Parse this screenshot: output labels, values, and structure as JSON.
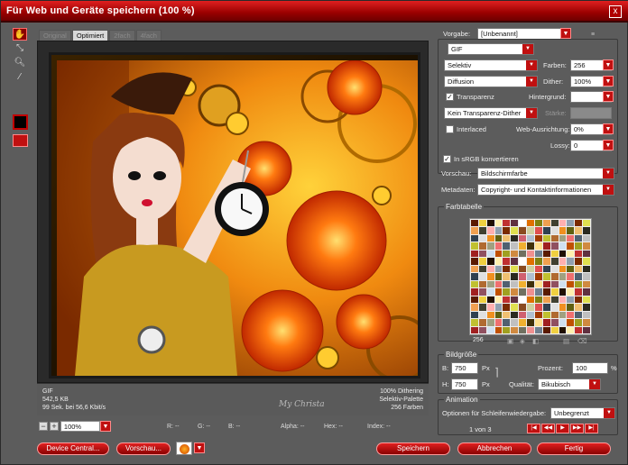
{
  "window": {
    "title": "Für Web und Geräte speichern (100 %)",
    "close": "x"
  },
  "tabs": [
    "Original",
    "Optimiert",
    "2fach",
    "4fach"
  ],
  "info_left": [
    "GIF",
    "542,5 KB",
    "99 Sek. bei 56,6 Kbit/s"
  ],
  "info_right": [
    "100% Dithering",
    "Selektiv-Palette",
    "256 Farben"
  ],
  "watermark": "My Christa",
  "status": {
    "zoom": "100%",
    "minus": "−",
    "plus": "+",
    "r": "R: --",
    "g": "G: --",
    "b": "B: --",
    "alpha": "Alpha: --",
    "hex": "Hex: --",
    "index": "Index: --"
  },
  "buttons": {
    "device_central": "Device Central...",
    "preview": "Vorschau...",
    "save": "Speichern",
    "cancel": "Abbrechen",
    "done": "Fertig"
  },
  "settings": {
    "vorgabe_label": "Vorgabe:",
    "vorgabe_value": "[Unbenannt]",
    "format": "GIF",
    "reduction": "Selektiv",
    "farben_label": "Farben:",
    "farben_value": "256",
    "dither_alg": "Diffusion",
    "dither_label": "Dither:",
    "dither_value": "100%",
    "transparenz_label": "Transparenz",
    "hintergrund_label": "Hintergrund:",
    "transp_dither": "Kein Transparenz-Dither",
    "staerke_label": "Stärke:",
    "interlaced_label": "Interlaced",
    "webausr_label": "Web-Ausrichtung:",
    "webausr_value": "0%",
    "lossy_label": "Lossy:",
    "lossy_value": "0",
    "srgb_label": "In sRGB konvertieren",
    "vorschau_label": "Vorschau:",
    "vorschau_value": "Bildschirmfarbe",
    "metadaten_label": "Metadaten:",
    "metadaten_value": "Copyright- und Kontaktinformationen"
  },
  "farbtabelle": {
    "title": "Farbtabelle",
    "count": "256"
  },
  "bildgroesse": {
    "title": "Bildgröße",
    "b_label": "B:",
    "b_value": "750",
    "h_label": "H:",
    "h_value": "750",
    "unit": "Px",
    "prozent_label": "Prozent:",
    "prozent_value": "100",
    "pct": "%",
    "qualitaet_label": "Qualität:",
    "qualitaet_value": "Bikubisch"
  },
  "animation": {
    "title": "Animation",
    "loop_label": "Optionen für Schleifenwiedergabe:",
    "loop_value": "Unbegrenzt",
    "frame": "1 von 3"
  },
  "colors": {
    "accent": "#c01010",
    "panel": "#5c5c5c"
  }
}
